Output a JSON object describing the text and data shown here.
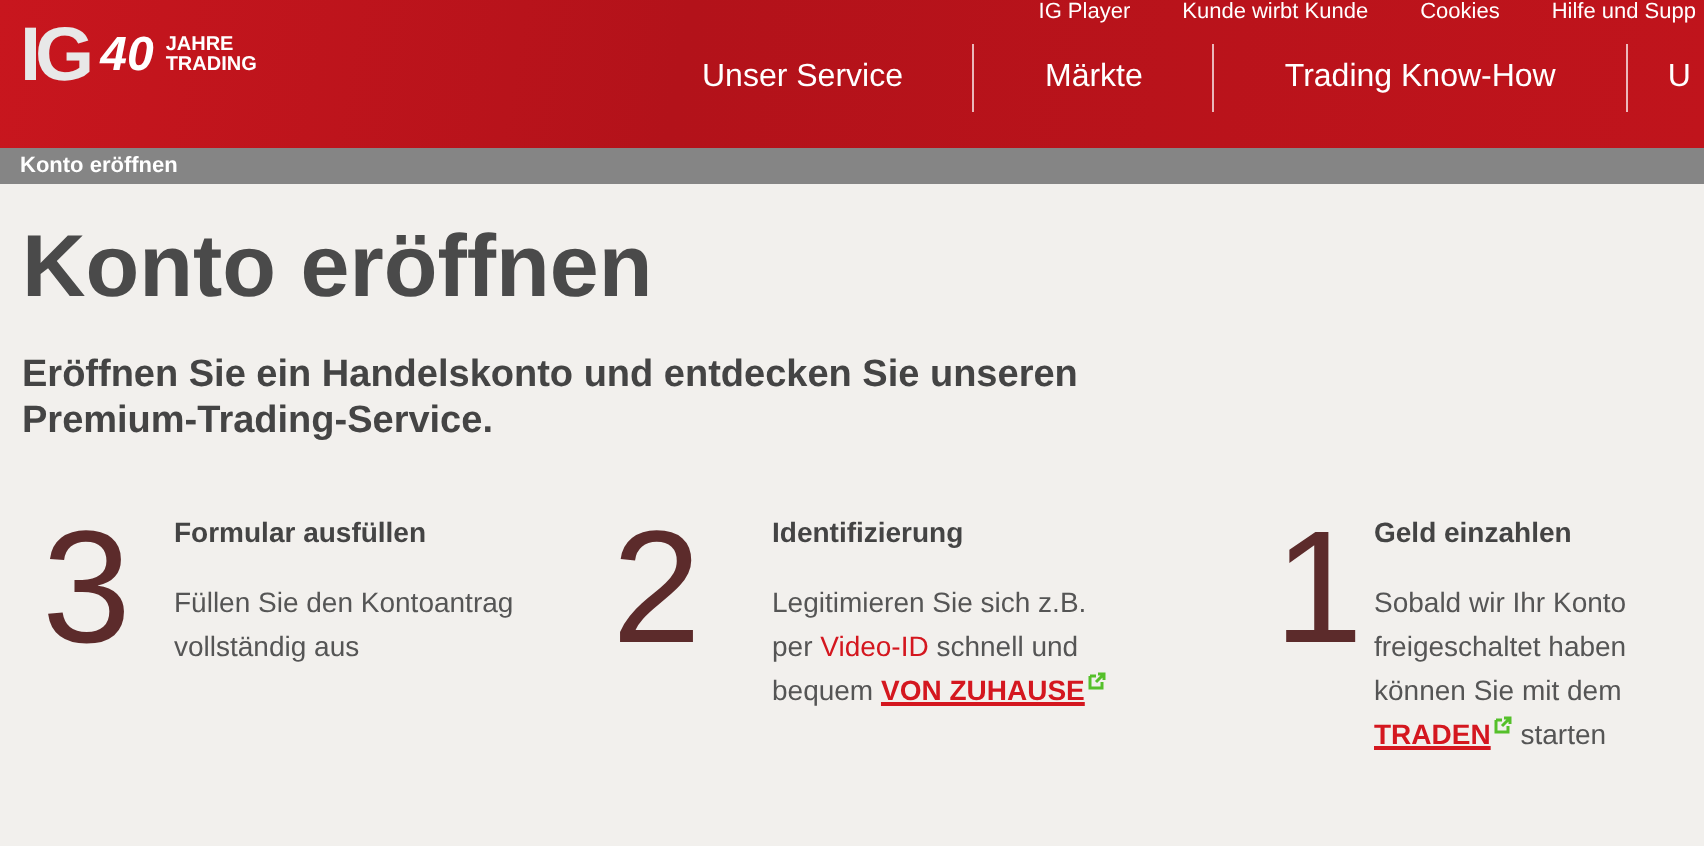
{
  "header": {
    "logo": {
      "mark": "IG",
      "years": "40",
      "line_1": "JAHRE",
      "line_2": "TRADING"
    },
    "top_links": [
      "IG Player",
      "Kunde wirbt Kunde",
      "Cookies",
      "Hilfe und Supp"
    ],
    "nav": [
      "Unser Service",
      "Märkte",
      "Trading Know-How",
      "U"
    ]
  },
  "breadcrumb": "Konto eröffnen",
  "title": "Konto eröffnen",
  "subtitle": "Eröffnen Sie ein Handelskonto und entdecken Sie unseren Premium-Trading-Service.",
  "steps": [
    {
      "number": "3",
      "title": "Formular ausfüllen",
      "parts": [
        {
          "kind": "text",
          "text": "Füllen Sie den Kontoantrag vollständig aus"
        }
      ]
    },
    {
      "number": "2",
      "title": "Identifizierung",
      "parts": [
        {
          "kind": "text",
          "text": "Legitimieren Sie sich z.B. per "
        },
        {
          "kind": "link",
          "text": "Video-ID"
        },
        {
          "kind": "text",
          "text": " schnell und bequem "
        },
        {
          "kind": "cta",
          "text": "VON ZUHAUSE"
        }
      ]
    },
    {
      "number": "1",
      "title": "Geld einzahlen",
      "parts": [
        {
          "kind": "text",
          "text": "Sobald wir Ihr Konto freigeschaltet haben können Sie mit dem "
        },
        {
          "kind": "cta",
          "text": "TRADEN"
        },
        {
          "kind": "text",
          "text": " starten"
        }
      ]
    }
  ]
}
